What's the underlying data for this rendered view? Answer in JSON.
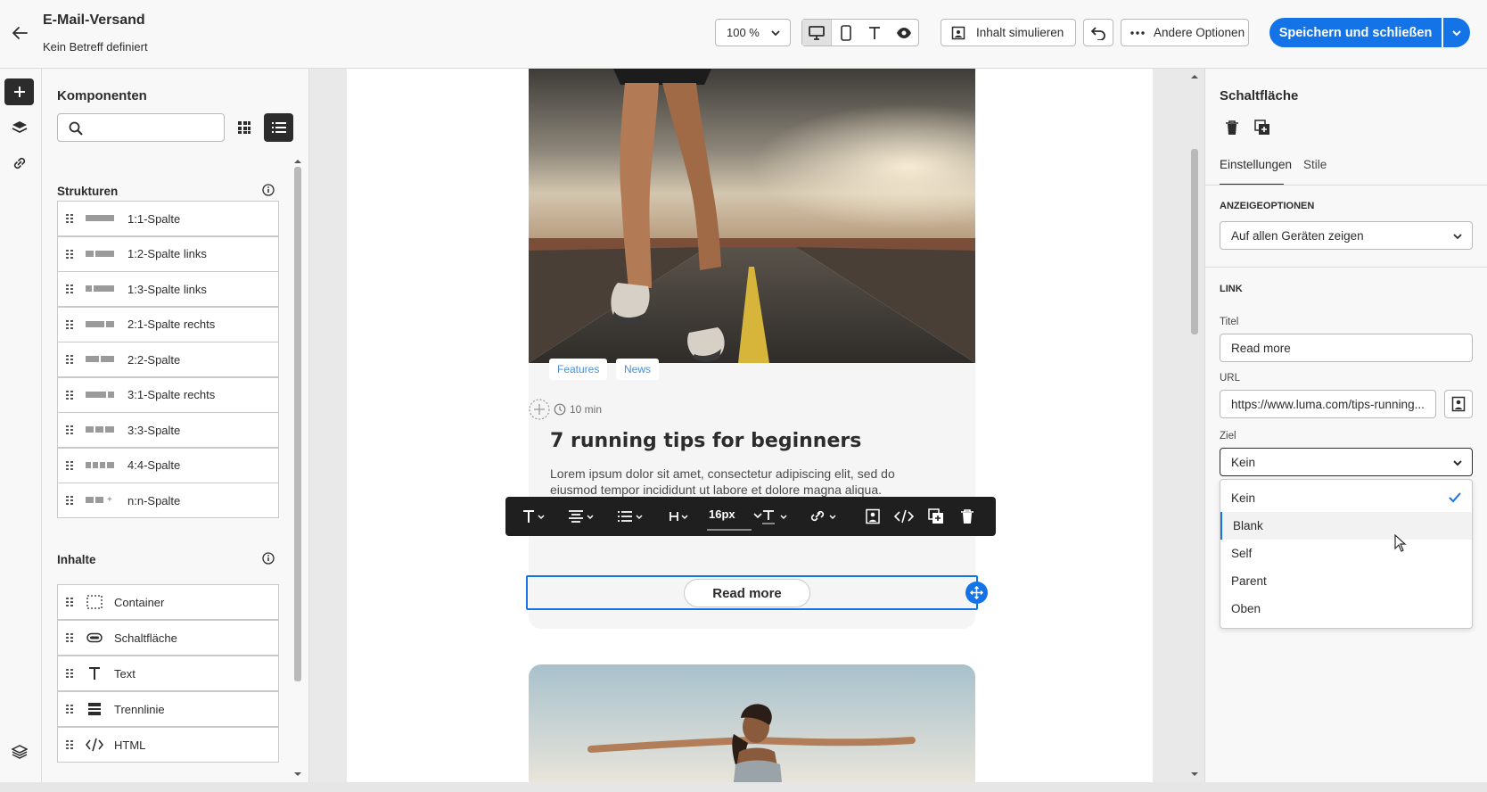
{
  "header": {
    "title": "E-Mail-Versand",
    "subtitle": "Kein Betreff definiert",
    "zoom": "100 %",
    "simulate_label": "Inhalt simulieren",
    "more_options_label": "Andere Optionen",
    "save_label": "Speichern und schließen"
  },
  "panel": {
    "title": "Komponenten",
    "search_placeholder": "",
    "structures_title": "Strukturen",
    "structures": [
      {
        "label": "1:1-Spalte"
      },
      {
        "label": "1:2-Spalte links"
      },
      {
        "label": "1:3-Spalte links"
      },
      {
        "label": "2:1-Spalte rechts"
      },
      {
        "label": "2:2-Spalte"
      },
      {
        "label": "3:1-Spalte rechts"
      },
      {
        "label": "3:3-Spalte"
      },
      {
        "label": "4:4-Spalte"
      },
      {
        "label": "n:n-Spalte"
      }
    ],
    "contents_title": "Inhalte",
    "contents": [
      {
        "label": "Container",
        "icon": "container-icon"
      },
      {
        "label": "Schaltfläche",
        "icon": "button-shape-icon"
      },
      {
        "label": "Text",
        "icon": "text-icon"
      },
      {
        "label": "Trennlinie",
        "icon": "divider-icon"
      },
      {
        "label": "HTML",
        "icon": "code-icon"
      }
    ]
  },
  "email": {
    "tags": [
      "Features",
      "News"
    ],
    "read_time": "10 min",
    "headline": "7 running tips for beginners",
    "body_line1": "Lorem ipsum dolor sit amet, consectetur adipiscing elit, sed do",
    "body_line2": "eiusmod tempor incididunt ut labore et dolore magna aliqua.",
    "cta_label": "Read more",
    "toolbar_font_size": "16px"
  },
  "props": {
    "title": "Schaltfläche",
    "tab_settings": "Einstellungen",
    "tab_styles": "Stile",
    "display_options_heading": "ANZEIGEOPTIONEN",
    "display_value": "Auf allen Geräten zeigen",
    "link_heading": "LINK",
    "title_label": "Titel",
    "title_value": "Read more",
    "url_label": "URL",
    "url_value": "https://www.luma.com/tips-running...",
    "target_label": "Ziel",
    "target_value": "Kein",
    "target_options": [
      "Kein",
      "Blank",
      "Self",
      "Parent",
      "Oben"
    ]
  },
  "colors": {
    "accent": "#1473e6",
    "selection": "#1473e6",
    "tag_text": "#4a8fd6"
  }
}
